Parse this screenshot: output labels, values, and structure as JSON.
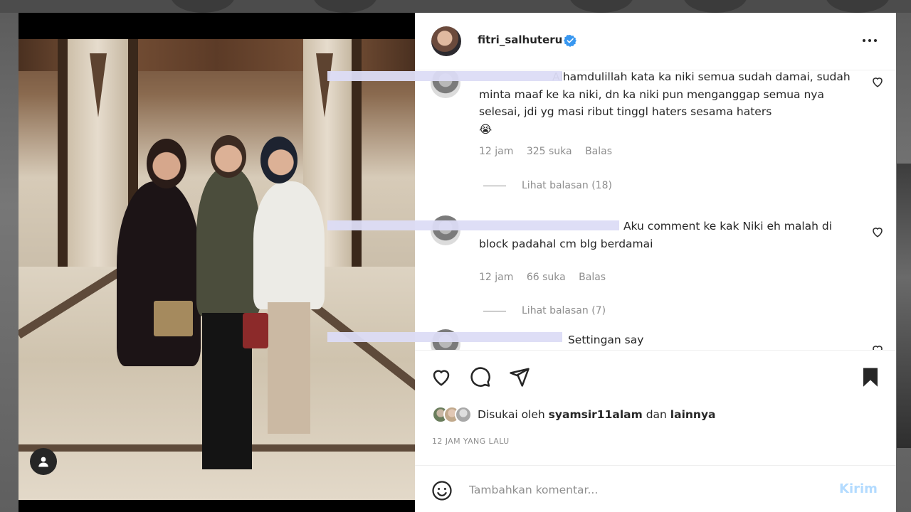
{
  "post": {
    "owner": {
      "username": "fitri_salhuteru",
      "verified": true
    },
    "comments": [
      {
        "username": "",
        "text": "Alhamdulillah kata ka niki semua sudah damai, sudah minta maaf ke ka niki, dn ka niki pun menganggap semua nya selesai, jdi yg masi ribut tinggl haters sesama haters",
        "emoji": "😭",
        "time": "12 jam",
        "likes": "325 suka",
        "reply_label": "Balas",
        "view_replies": "Lihat balasan (18)"
      },
      {
        "username": "",
        "text": "Aku comment ke kak Niki eh malah di block padahal cm blg berdamai",
        "time": "12 jam",
        "likes": "66 suka",
        "reply_label": "Balas",
        "view_replies": "Lihat balasan (7)"
      },
      {
        "username": "",
        "text": "Settingan say"
      }
    ],
    "likes_prefix": "Disukai oleh",
    "liked_by": "syamsir11alam",
    "likes_joiner": "dan",
    "likes_others": "lainnya",
    "time_ago": "12 JAM YANG LALU",
    "composer": {
      "placeholder": "Tambahkan komentar...",
      "post_label": "Kirim"
    }
  },
  "colors": {
    "verified": "#3897f0",
    "post_button_disabled": "#b3dbff",
    "meta_text": "#8e8e8e"
  },
  "icons": {
    "like": "heart-icon",
    "comment": "comment-icon",
    "share": "send-icon",
    "save": "bookmark-icon",
    "emoji": "emoji-icon",
    "more": "more-options-icon"
  }
}
